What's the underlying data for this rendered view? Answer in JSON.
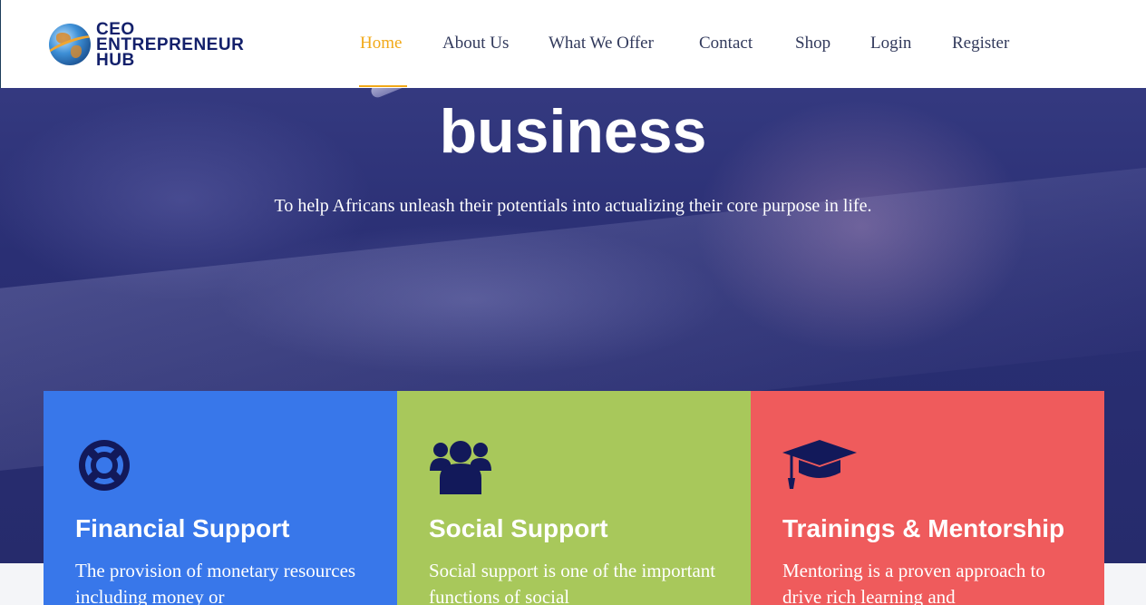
{
  "header": {
    "logo": {
      "line1": "CEO",
      "line2": "ENTREPRENEUR",
      "line3": "HUB",
      "icon": "globe-icon"
    },
    "nav": [
      {
        "label": "Home",
        "active": true
      },
      {
        "label": "About Us",
        "active": false
      },
      {
        "label": "What We Offer",
        "active": false
      },
      {
        "label": "Contact",
        "active": false
      },
      {
        "label": "Shop",
        "active": false
      },
      {
        "label": "Login",
        "active": false
      },
      {
        "label": "Register",
        "active": false
      }
    ],
    "active_color": "#f2a918",
    "nav_color": "#323a5c"
  },
  "hero": {
    "title": "business",
    "subtitle": "To help Africans unleash their potentials into actualizing their core purpose in life."
  },
  "features": [
    {
      "icon": "life-ring-icon",
      "title": "Financial Support",
      "text": "The provision of monetary resources including money or",
      "color": "#3877ea"
    },
    {
      "icon": "users-icon",
      "title": "Social Support",
      "text": "Social support is one of the important functions of social",
      "color": "#a8c85b"
    },
    {
      "icon": "graduation-cap-icon",
      "title": "Trainings & Mentorship",
      "text": "Mentoring is a proven approach to drive rich learning and",
      "color": "#ef5b5c"
    }
  ],
  "icon_color": "#12195a"
}
